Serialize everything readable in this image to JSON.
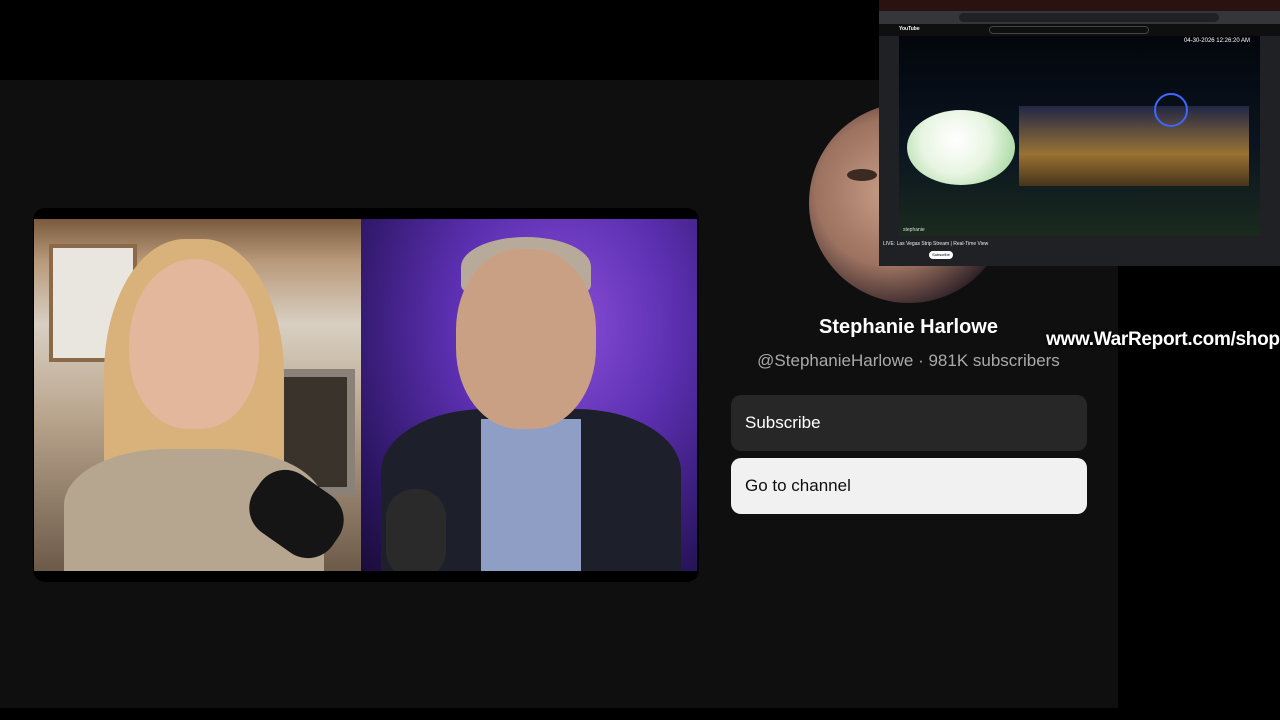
{
  "channel": {
    "name": "Stephanie Harlowe",
    "handle": "@StephanieHarlowe",
    "subscribers": "981K subscribers",
    "separator": " · "
  },
  "buttons": {
    "subscribe": "Subscribe",
    "go_to_channel": "Go to channel"
  },
  "watermark": "www.WarReport.com/shop",
  "pip": {
    "timestamp": "04-30-2026 12:26:20 AM",
    "video_title": "LIVE: Las Vegas Strip Stream | Real-Time View",
    "logo": "YouTube",
    "subscribe_label": "Subscribe",
    "overlay_name": "stephanie"
  },
  "colors": {
    "page_bg": "#0f0f0f",
    "button_dark": "#272727",
    "button_light": "#f1f1f1",
    "meta_text": "#aaaaaa"
  }
}
